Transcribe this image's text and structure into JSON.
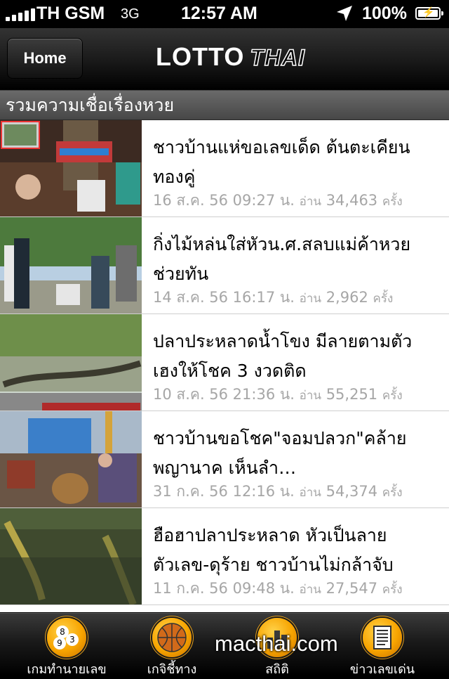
{
  "status_bar": {
    "carrier": "TH GSM",
    "network": "3G",
    "time": "12:57 AM",
    "battery": "100%",
    "signal_bars": 5,
    "icons": [
      "signal-icon",
      "location-arrow-icon",
      "battery-charging-icon"
    ]
  },
  "nav": {
    "home_label": "Home",
    "logo_primary": "LOTTO",
    "logo_secondary": "THAI"
  },
  "section": {
    "title": "รวมความเชื่อเรื่องหวย"
  },
  "articles": [
    {
      "title": "ชาวบ้านแห่ขอเลขเด็ด ต้นตะเคียนทองคู่",
      "date": "16 ส.ค. 56 09:27 น.",
      "reads_prefix": "อ่าน",
      "reads": "34,463",
      "reads_suffix": "ครั้ง"
    },
    {
      "title": "กิ่งไม้หล่นใส่หัวน.ศ.สลบแม่ค้าหวยช่วยทัน",
      "date": "14 ส.ค. 56 16:17 น.",
      "reads_prefix": "อ่าน",
      "reads": "2,962",
      "reads_suffix": "ครั้ง"
    },
    {
      "title": "ปลาประหลาดน้ำโขง มีลายตามตัว เฮงให้โชค 3 งวดติด",
      "date": "10 ส.ค. 56 21:36 น.",
      "reads_prefix": "อ่าน",
      "reads": "55,251",
      "reads_suffix": "ครั้ง"
    },
    {
      "title": "ชาวบ้านขอโชค\"จอมปลวก\"คล้ายพญานาค เห็นลำ…",
      "date": "31 ก.ค. 56 12:16 น.",
      "reads_prefix": "อ่าน",
      "reads": "54,374",
      "reads_suffix": "ครั้ง"
    },
    {
      "title": "ฮือฮาปลาประหลาด หัวเป็นลายตัวเลข-ดุร้าย ชาวบ้านไม่กล้าจับ",
      "date": "11 ก.ค. 56 09:48 น.",
      "reads_prefix": "อ่าน",
      "reads": "27,547",
      "reads_suffix": "ครั้ง"
    }
  ],
  "tabs": [
    {
      "label": "เกมทำนายเลข",
      "icon": "lotto-balls-icon"
    },
    {
      "label": "เกจิชี้ทาง",
      "icon": "basketball-icon"
    },
    {
      "label": "สถิติ",
      "icon": "bar-chart-icon"
    },
    {
      "label": "ข่าวเลขเด่น",
      "icon": "news-icon"
    }
  ],
  "watermark": "macthai.com"
}
